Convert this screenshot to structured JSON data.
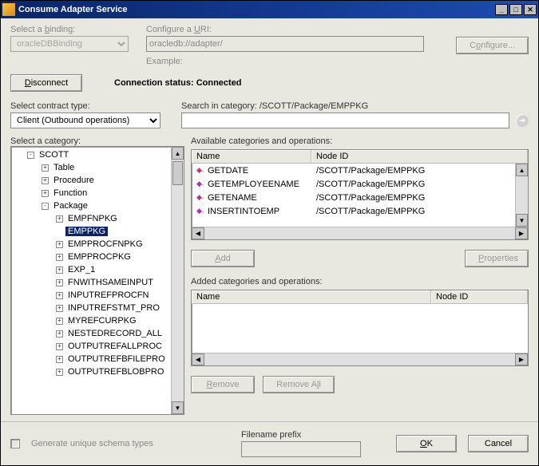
{
  "window": {
    "title": "Consume Adapter Service"
  },
  "binding": {
    "label_prefix": "Select a ",
    "label_key": "b",
    "label_suffix": "inding:",
    "value": "oracleDBBinding"
  },
  "uri": {
    "label_prefix": "Configure a ",
    "label_key": "U",
    "label_suffix": "RI:",
    "value": "oracledb://adapter/",
    "exampleLabel": "Example:",
    "configureBtn_prefix": "C",
    "configureBtn_key": "o",
    "configureBtn_suffix": "nfigure..."
  },
  "connect": {
    "disconnectBtn_key": "D",
    "disconnectBtn_suffix": "isconnect",
    "statusLabel": "Connection status:",
    "statusValue": "Connected"
  },
  "contract": {
    "label": "Select contract type:",
    "value": "Client (Outbound operations)"
  },
  "search": {
    "labelPrefix": "Search in category: ",
    "path": "/SCOTT/Package/EMPPKG",
    "value": ""
  },
  "categoryLabel": "Select a category:",
  "tree": {
    "root": "SCOTT",
    "children": [
      {
        "label": "Table",
        "exp": "+"
      },
      {
        "label": "Procedure",
        "exp": "+"
      },
      {
        "label": "Function",
        "exp": "+"
      },
      {
        "label": "Package",
        "exp": "-",
        "children": [
          {
            "label": "EMPFNPKG",
            "exp": "+"
          },
          {
            "label": "EMPPKG",
            "exp": "",
            "selected": true
          },
          {
            "label": "EMPPROCFNPKG",
            "exp": "+"
          },
          {
            "label": "EMPPROCPKG",
            "exp": "+"
          },
          {
            "label": "EXP_1",
            "exp": "+"
          },
          {
            "label": "FNWITHSAMEINPUT",
            "exp": "+"
          },
          {
            "label": "INPUTREFPROCFN",
            "exp": "+"
          },
          {
            "label": "INPUTREFSTMT_PRO",
            "exp": "+"
          },
          {
            "label": "MYREFCURPKG",
            "exp": "+"
          },
          {
            "label": "NESTEDRECORD_ALL",
            "exp": "+"
          },
          {
            "label": "OUTPUTREFALLPROC",
            "exp": "+"
          },
          {
            "label": "OUTPUTREFBFILEPRO",
            "exp": "+"
          },
          {
            "label": "OUTPUTREFBLOBPRO",
            "exp": "+"
          }
        ]
      }
    ]
  },
  "available": {
    "label": "Available categories and operations:",
    "cols": {
      "name": "Name",
      "nodeId": "Node ID"
    },
    "rows": [
      {
        "name": "GETDATE",
        "nodeId": "/SCOTT/Package/EMPPKG"
      },
      {
        "name": "GETEMPLOYEENAME",
        "nodeId": "/SCOTT/Package/EMPPKG"
      },
      {
        "name": "GETENAME",
        "nodeId": "/SCOTT/Package/EMPPKG"
      },
      {
        "name": "INSERTINTOEMP",
        "nodeId": "/SCOTT/Package/EMPPKG"
      }
    ],
    "addBtn_key": "A",
    "addBtn_suffix": "dd",
    "propsBtn_key": "P",
    "propsBtn_suffix": "roperties"
  },
  "added": {
    "label": "Added categories and operations:",
    "cols": {
      "name": "Name",
      "nodeId": "Node ID"
    },
    "removeBtn_key": "R",
    "removeBtn_suffix": "emove",
    "removeAllBtn_prefix": "Remove A",
    "removeAllBtn_key": "l",
    "removeAllBtn_suffix": "l"
  },
  "bottom": {
    "genSchema": "Generate unique schema types",
    "filePrefixLabel": "Filename prefix",
    "filePrefixValue": "",
    "okBtn_key": "O",
    "okBtn_suffix": "K",
    "cancelBtn": "Cancel"
  }
}
